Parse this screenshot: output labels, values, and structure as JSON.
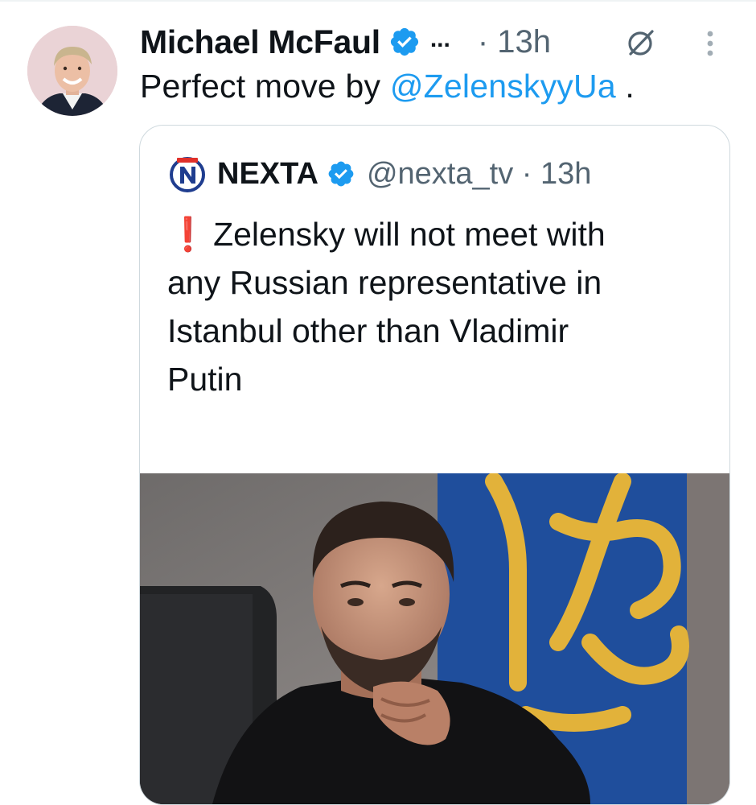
{
  "tweet": {
    "author_name": "Michael McFaul",
    "name_ellipsis": "...",
    "time": "· 13h",
    "text_prefix": "Perfect move by ",
    "mention": "@ZelenskyyUa",
    "text_suffix": " ."
  },
  "quote": {
    "author_name": "NEXTA",
    "handle_time": "@nexta_tv · 13h",
    "exclaim": "❗",
    "lines": [
      "Zelensky will not meet with",
      "any Russian representative in",
      "Istanbul other than Vladimir",
      "Putin"
    ],
    "ellipsis": "..."
  },
  "icons": {
    "verified": "verified-badge-icon",
    "grok": "grok-icon",
    "more": "more-options-icon",
    "nexta_logo": "nexta-logo"
  },
  "colors": {
    "link": "#1d9bf0",
    "verified": "#1d9bf0",
    "secondary_text": "#536471",
    "flag_blue": "#1f4e9c",
    "flag_gold": "#e2b23a"
  }
}
